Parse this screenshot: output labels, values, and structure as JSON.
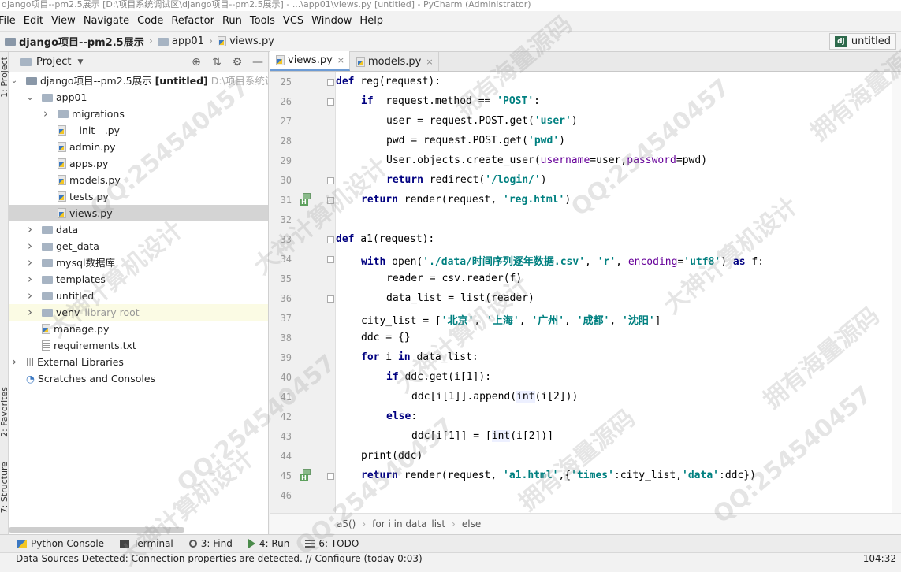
{
  "window": {
    "title": "django项目--pm2.5展示 [D:\\项目系统调试区\\django项目--pm2.5展示] - ...\\app01\\views.py [untitled] - PyCharm (Administrator)"
  },
  "menu": [
    "File",
    "Edit",
    "View",
    "Navigate",
    "Code",
    "Refactor",
    "Run",
    "Tools",
    "VCS",
    "Window",
    "Help"
  ],
  "breadcrumb": {
    "project": "django项目--pm2.5展示",
    "folder": "app01",
    "file": "views.py"
  },
  "run_config": {
    "label": "untitled",
    "badge": "dj"
  },
  "left_tools": {
    "project": "1: Project",
    "favorites": "2: Favorites",
    "structure": "7: Structure"
  },
  "project_panel": {
    "header": "Project",
    "root_name": "django项目--pm2.5展示",
    "root_module": "[untitled]",
    "root_path": "D:\\项目系统调试",
    "items": [
      {
        "label": "app01",
        "indent": 1,
        "type": "folder",
        "expanded": true
      },
      {
        "label": "migrations",
        "indent": 2,
        "type": "folder",
        "expanded": false
      },
      {
        "label": "__init__.py",
        "indent": 2,
        "type": "py"
      },
      {
        "label": "admin.py",
        "indent": 2,
        "type": "py"
      },
      {
        "label": "apps.py",
        "indent": 2,
        "type": "py"
      },
      {
        "label": "models.py",
        "indent": 2,
        "type": "py"
      },
      {
        "label": "tests.py",
        "indent": 2,
        "type": "py"
      },
      {
        "label": "views.py",
        "indent": 2,
        "type": "py",
        "selected": true
      },
      {
        "label": "data",
        "indent": 1,
        "type": "folder",
        "expanded": false
      },
      {
        "label": "get_data",
        "indent": 1,
        "type": "folder",
        "expanded": false
      },
      {
        "label": "mysql数据库",
        "indent": 1,
        "type": "folder",
        "expanded": false
      },
      {
        "label": "templates",
        "indent": 1,
        "type": "folder",
        "expanded": false
      },
      {
        "label": "untitled",
        "indent": 1,
        "type": "folder",
        "expanded": false
      },
      {
        "label": "venv",
        "indent": 1,
        "type": "folder",
        "expanded": false,
        "hint": "library root"
      },
      {
        "label": "manage.py",
        "indent": 1,
        "type": "py"
      },
      {
        "label": "requirements.txt",
        "indent": 1,
        "type": "txt"
      },
      {
        "label": "External Libraries",
        "indent": 0,
        "type": "lib",
        "expanded": false
      },
      {
        "label": "Scratches and Consoles",
        "indent": 0,
        "type": "scratch"
      }
    ]
  },
  "editor": {
    "tabs": [
      {
        "label": "views.py",
        "active": true
      },
      {
        "label": "models.py",
        "active": false
      }
    ],
    "lines": [
      {
        "n": "25",
        "indent": 0,
        "html": "<span class='kw'>def</span> reg(request):"
      },
      {
        "n": "26",
        "indent": 1,
        "html": "<span class='kw'>if</span>  request.method == <span class='str'>'POST'</span>:"
      },
      {
        "n": "27",
        "indent": 2,
        "html": "user = request.POST.get(<span class='str'>'user'</span>)"
      },
      {
        "n": "28",
        "indent": 2,
        "html": "pwd = request.POST.get(<span class='str'>'pwd'</span>)"
      },
      {
        "n": "29",
        "indent": 2,
        "html": "User.objects.create_user(<span class='prm'>username</span>=user,<span class='prm'>password</span>=pwd)"
      },
      {
        "n": "30",
        "indent": 2,
        "html": "<span class='kw'>return</span> redirect(<span class='str'>'/login/'</span>)"
      },
      {
        "n": "31",
        "indent": 1,
        "html": "<span class='kw'>return</span> render(request, <span class='str'>'reg.html'</span>)"
      },
      {
        "n": "32",
        "indent": 0,
        "html": ""
      },
      {
        "n": "33",
        "indent": 0,
        "html": "<span class='kw'>def</span> a1(request):"
      },
      {
        "n": "34",
        "indent": 1,
        "html": "<span class='kw'>with</span> open(<span class='str'>'./data/时间序列逐年数据.csv'</span>, <span class='str'>'r'</span>, <span class='prm'>encoding</span>=<span class='str'>'utf8'</span>) <span class='kw'>as</span> f:"
      },
      {
        "n": "35",
        "indent": 2,
        "html": "reader = csv.reader(f)"
      },
      {
        "n": "36",
        "indent": 2,
        "html": "data_list = list(reader)"
      },
      {
        "n": "37",
        "indent": 1,
        "html": "city_list = [<span class='str'>'北京'</span>, <span class='str'>'上海'</span>, <span class='str'>'广州'</span>, <span class='str'>'成都'</span>, <span class='str'>'沈阳'</span>]"
      },
      {
        "n": "38",
        "indent": 1,
        "html": "ddc = {}"
      },
      {
        "n": "39",
        "indent": 1,
        "html": "<span class='kw'>for</span> i <span class='kw'>in</span> data_list:"
      },
      {
        "n": "40",
        "indent": 2,
        "html": "<span class='kw'>if</span> ddc.get(i[1]):"
      },
      {
        "n": "41",
        "indent": 3,
        "html": "ddc[i[1]].append(<span class='bi'>int</span>(i[2]))"
      },
      {
        "n": "42",
        "indent": 2,
        "html": "<span class='kw'>else</span>:"
      },
      {
        "n": "43",
        "indent": 3,
        "html": "ddc[i[1]] = [<span class='bi'>int</span>(i[2])]"
      },
      {
        "n": "44",
        "indent": 1,
        "html": "print(ddc)"
      },
      {
        "n": "45",
        "indent": 1,
        "html": "<span class='kw'>return</span> render(request, <span class='str'>'a1.html'</span>,{<span class='str'>'times'</span>:city_list,<span class='str'>'data'</span>:ddc})"
      },
      {
        "n": "46",
        "indent": 0,
        "html": ""
      }
    ],
    "breadcrumb": [
      "a5()",
      "for i in data_list",
      "else"
    ]
  },
  "bottom_tools": [
    {
      "label": "Python Console",
      "icon": "python-console-icon"
    },
    {
      "label": "Terminal",
      "icon": "terminal-icon"
    },
    {
      "label": "3: Find",
      "icon": "find-icon"
    },
    {
      "label": "4: Run",
      "icon": "run-icon"
    },
    {
      "label": "6: TODO",
      "icon": "todo-icon"
    }
  ],
  "status": {
    "message": "Data Sources Detected: Connection properties are detected. // Configure (today 0:03)",
    "position": "104:32"
  },
  "watermarks": [
    "QQ:254540457",
    "大神计算机设计",
    "拥有海量源码"
  ]
}
